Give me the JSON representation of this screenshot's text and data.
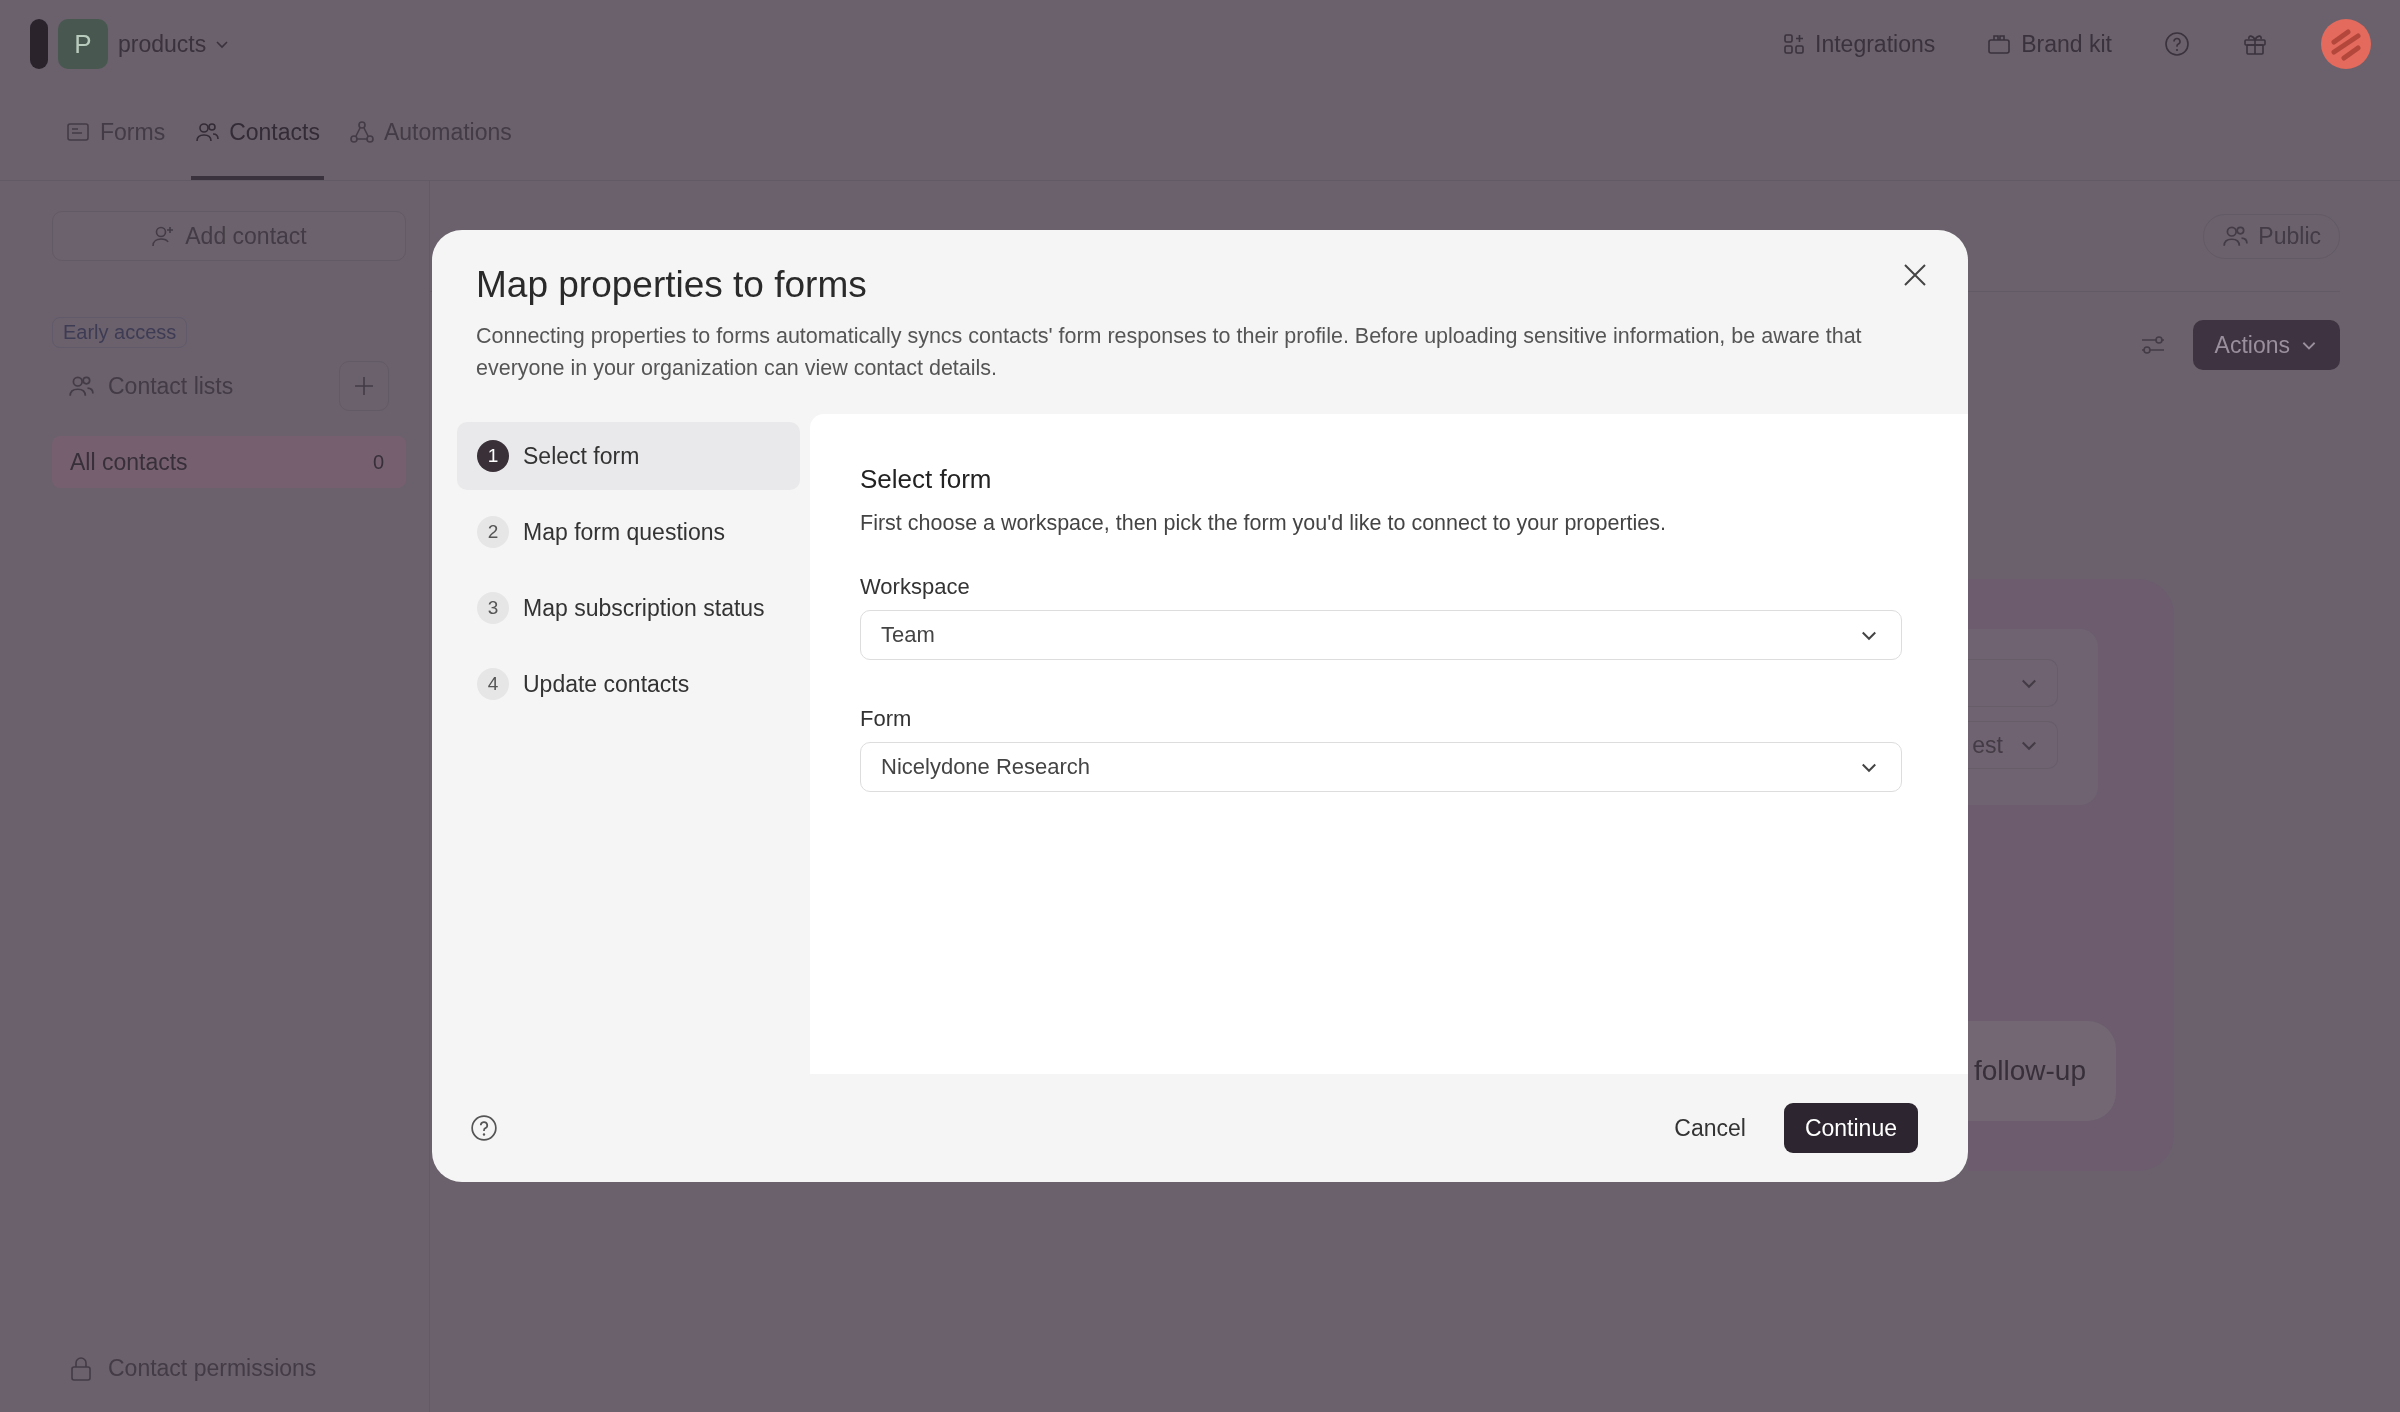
{
  "workspace": {
    "initial": "P",
    "name": "products"
  },
  "header_links": [
    {
      "kind": "integrations",
      "label": "Integrations"
    },
    {
      "kind": "brand",
      "label": "Brand kit"
    }
  ],
  "tabs": [
    {
      "kind": "forms",
      "label": "Forms",
      "selected": false
    },
    {
      "kind": "contacts",
      "label": "Contacts",
      "selected": true
    },
    {
      "kind": "automations",
      "label": "Automations",
      "selected": false
    }
  ],
  "sidebar": {
    "add_button": "Add contact",
    "badge": "Early access",
    "lists_label": "Contact lists",
    "items": [
      {
        "label": "All contacts",
        "count": "0",
        "selected": true
      }
    ],
    "footer": "Contact permissions"
  },
  "main": {
    "visibility": "Public",
    "actions": "Actions",
    "preview_select": "est",
    "preview_pill": "follow-up"
  },
  "modal": {
    "title": "Map properties to forms",
    "description": "Connecting properties to forms automatically syncs contacts' form responses to their profile. Before uploading sensitive information, be aware that everyone in your organization can view contact details.",
    "steps": [
      {
        "number": "1",
        "label": "Select form",
        "selected": true
      },
      {
        "number": "2",
        "label": "Map form questions",
        "selected": false
      },
      {
        "number": "3",
        "label": "Map subscription status",
        "selected": false
      },
      {
        "number": "4",
        "label": "Update contacts",
        "selected": false
      }
    ],
    "section_title": "Select form",
    "section_text": "First choose a workspace, then pick the form you'd like to connect to your properties.",
    "fields": [
      {
        "label": "Workspace",
        "value": "Team"
      },
      {
        "label": "Form",
        "value": "Nicelydone Research"
      }
    ],
    "cancel": "Cancel",
    "continue": "Continue"
  }
}
